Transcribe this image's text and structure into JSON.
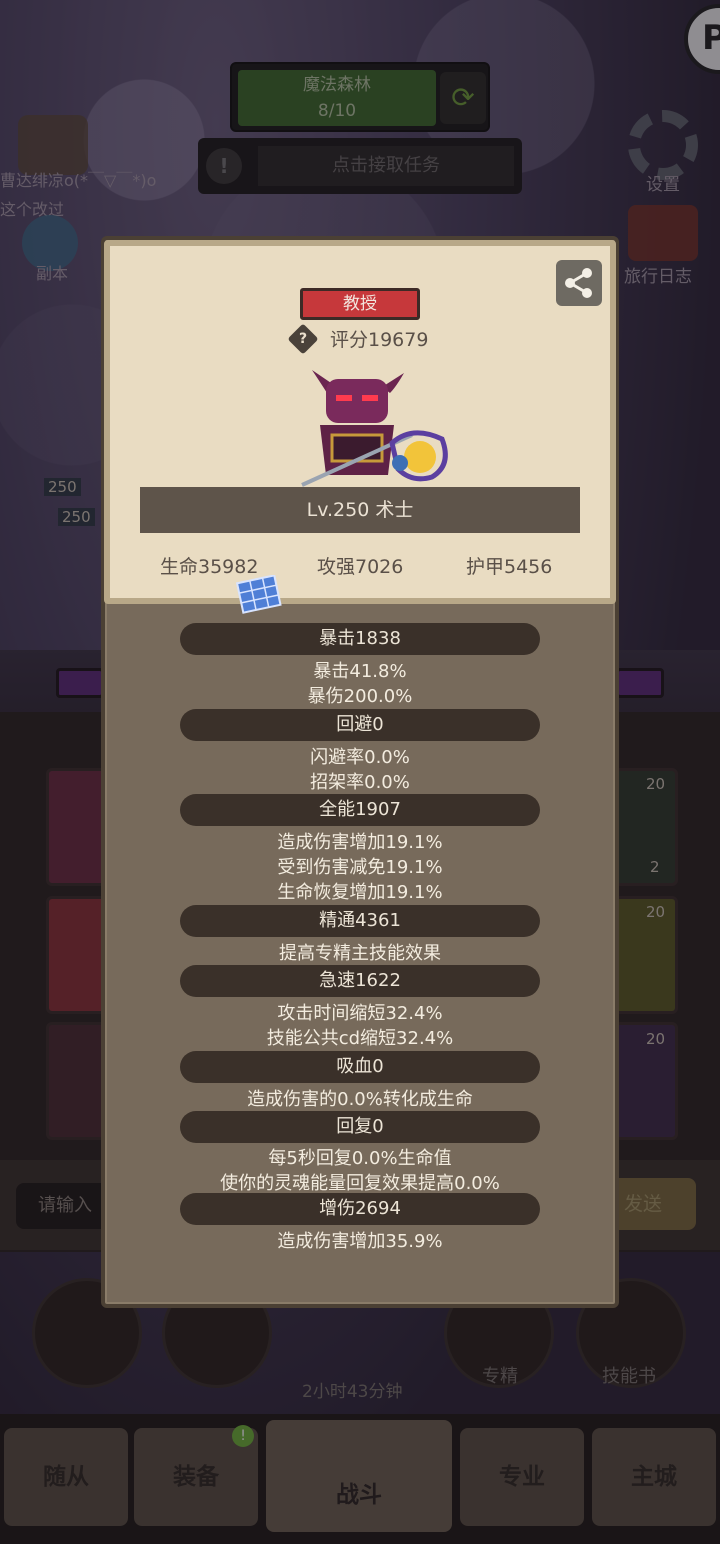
{
  "background": {
    "map": {
      "name": "魔法森林",
      "progress": "8/10"
    },
    "quest": {
      "text": "点击接取任务"
    },
    "left_texts": [
      "曹达绯凉o(*￣▽￣*)o",
      "这个改过",
      "副本"
    ],
    "right_texts": {
      "settings": "设置",
      "journal": "旅行日志"
    },
    "corner_badge": "P",
    "bg_level_tags": [
      "250",
      "250"
    ],
    "bg_slot_numbers": [
      "20",
      "2",
      "20",
      "20"
    ],
    "chat": {
      "input_placeholder": "请输入",
      "send_label": "发送"
    },
    "skills": {
      "specialty": "专精",
      "skillbook": "技能书"
    },
    "timer": "2小时43分钟",
    "nav": {
      "follower": "随从",
      "equipment": "装备",
      "battle": "战斗",
      "profession": "专业",
      "city": "主城"
    },
    "nav_badge": "!"
  },
  "card": {
    "title": "教授",
    "score": "评分19679",
    "level_class": "Lv.250 术士",
    "stats": {
      "hp": "生命35982",
      "attack": "攻强7026",
      "armor": "护甲5456"
    }
  },
  "attributes": [
    {
      "header": "暴击1838",
      "lines": [
        "暴击41.8%",
        "暴伤200.0%"
      ]
    },
    {
      "header": "回避0",
      "lines": [
        "闪避率0.0%",
        "招架率0.0%"
      ]
    },
    {
      "header": "全能1907",
      "lines": [
        "造成伤害增加19.1%",
        "受到伤害减免19.1%",
        "生命恢复增加19.1%"
      ]
    },
    {
      "header": "精通4361",
      "lines": [
        "提高专精主技能效果"
      ]
    },
    {
      "header": "急速1622",
      "lines": [
        "攻击时间缩短32.4%",
        "技能公共cd缩短32.4%"
      ]
    },
    {
      "header": "吸血0",
      "lines": [
        "造成伤害的0.0%转化成生命"
      ]
    },
    {
      "header": "回复0",
      "lines": [
        "每5秒回复0.0%生命值",
        "使你的灵魂能量回复效果提高0.0%"
      ]
    },
    {
      "header": "增伤2694",
      "lines": [
        "造成伤害增加35.9%"
      ]
    }
  ],
  "colors": {
    "panel_bg": "#776a5b",
    "card_bg": "#e9dcc2",
    "title_tag": "#c6383b",
    "section_bar": "#3a3029"
  },
  "icons": {
    "share": "share-icon",
    "help": "question-diamond-icon",
    "blueprint": "blueprint-icon"
  }
}
